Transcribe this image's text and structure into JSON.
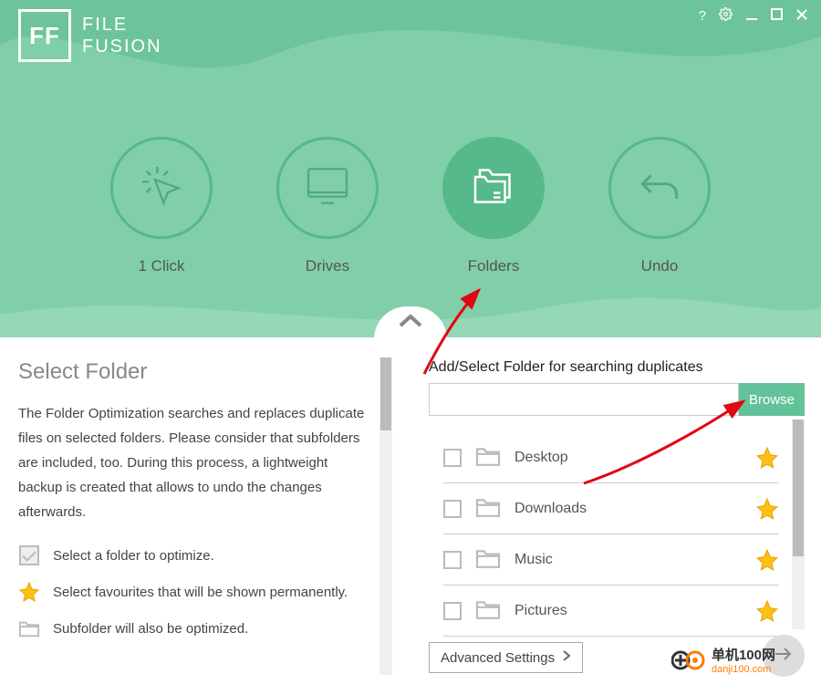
{
  "app": {
    "name_line1": "FILE",
    "name_line2": "FUSION",
    "logo_letters": "FF"
  },
  "nav": {
    "items": [
      {
        "label": "1 Click"
      },
      {
        "label": "Drives"
      },
      {
        "label": "Folders"
      },
      {
        "label": "Undo"
      }
    ],
    "active_index": 2
  },
  "left": {
    "heading": "Select Folder",
    "description": "The Folder Optimization searches and replaces duplicate files on selected folders. Please consider that subfolders are included, too. During this process, a lightweight backup is created that allows to undo the changes afterwards.",
    "legend": [
      "Select a folder to optimize.",
      "Select favourites that will be shown permanently.",
      "Subfolder will also be optimized."
    ]
  },
  "right": {
    "label": "Add/Select Folder for searching duplicates",
    "browse_label": "Browse",
    "input_value": "",
    "folders": [
      {
        "name": "Desktop"
      },
      {
        "name": "Downloads"
      },
      {
        "name": "Music"
      },
      {
        "name": "Pictures"
      }
    ],
    "advanced_label": "Advanced Settings"
  },
  "colors": {
    "accent": "#62c299",
    "header": "#80cfa9",
    "star": "#ffc016",
    "arrow": "#e30613"
  },
  "watermark": {
    "cn": "单机100网",
    "en": "danji100.com"
  }
}
